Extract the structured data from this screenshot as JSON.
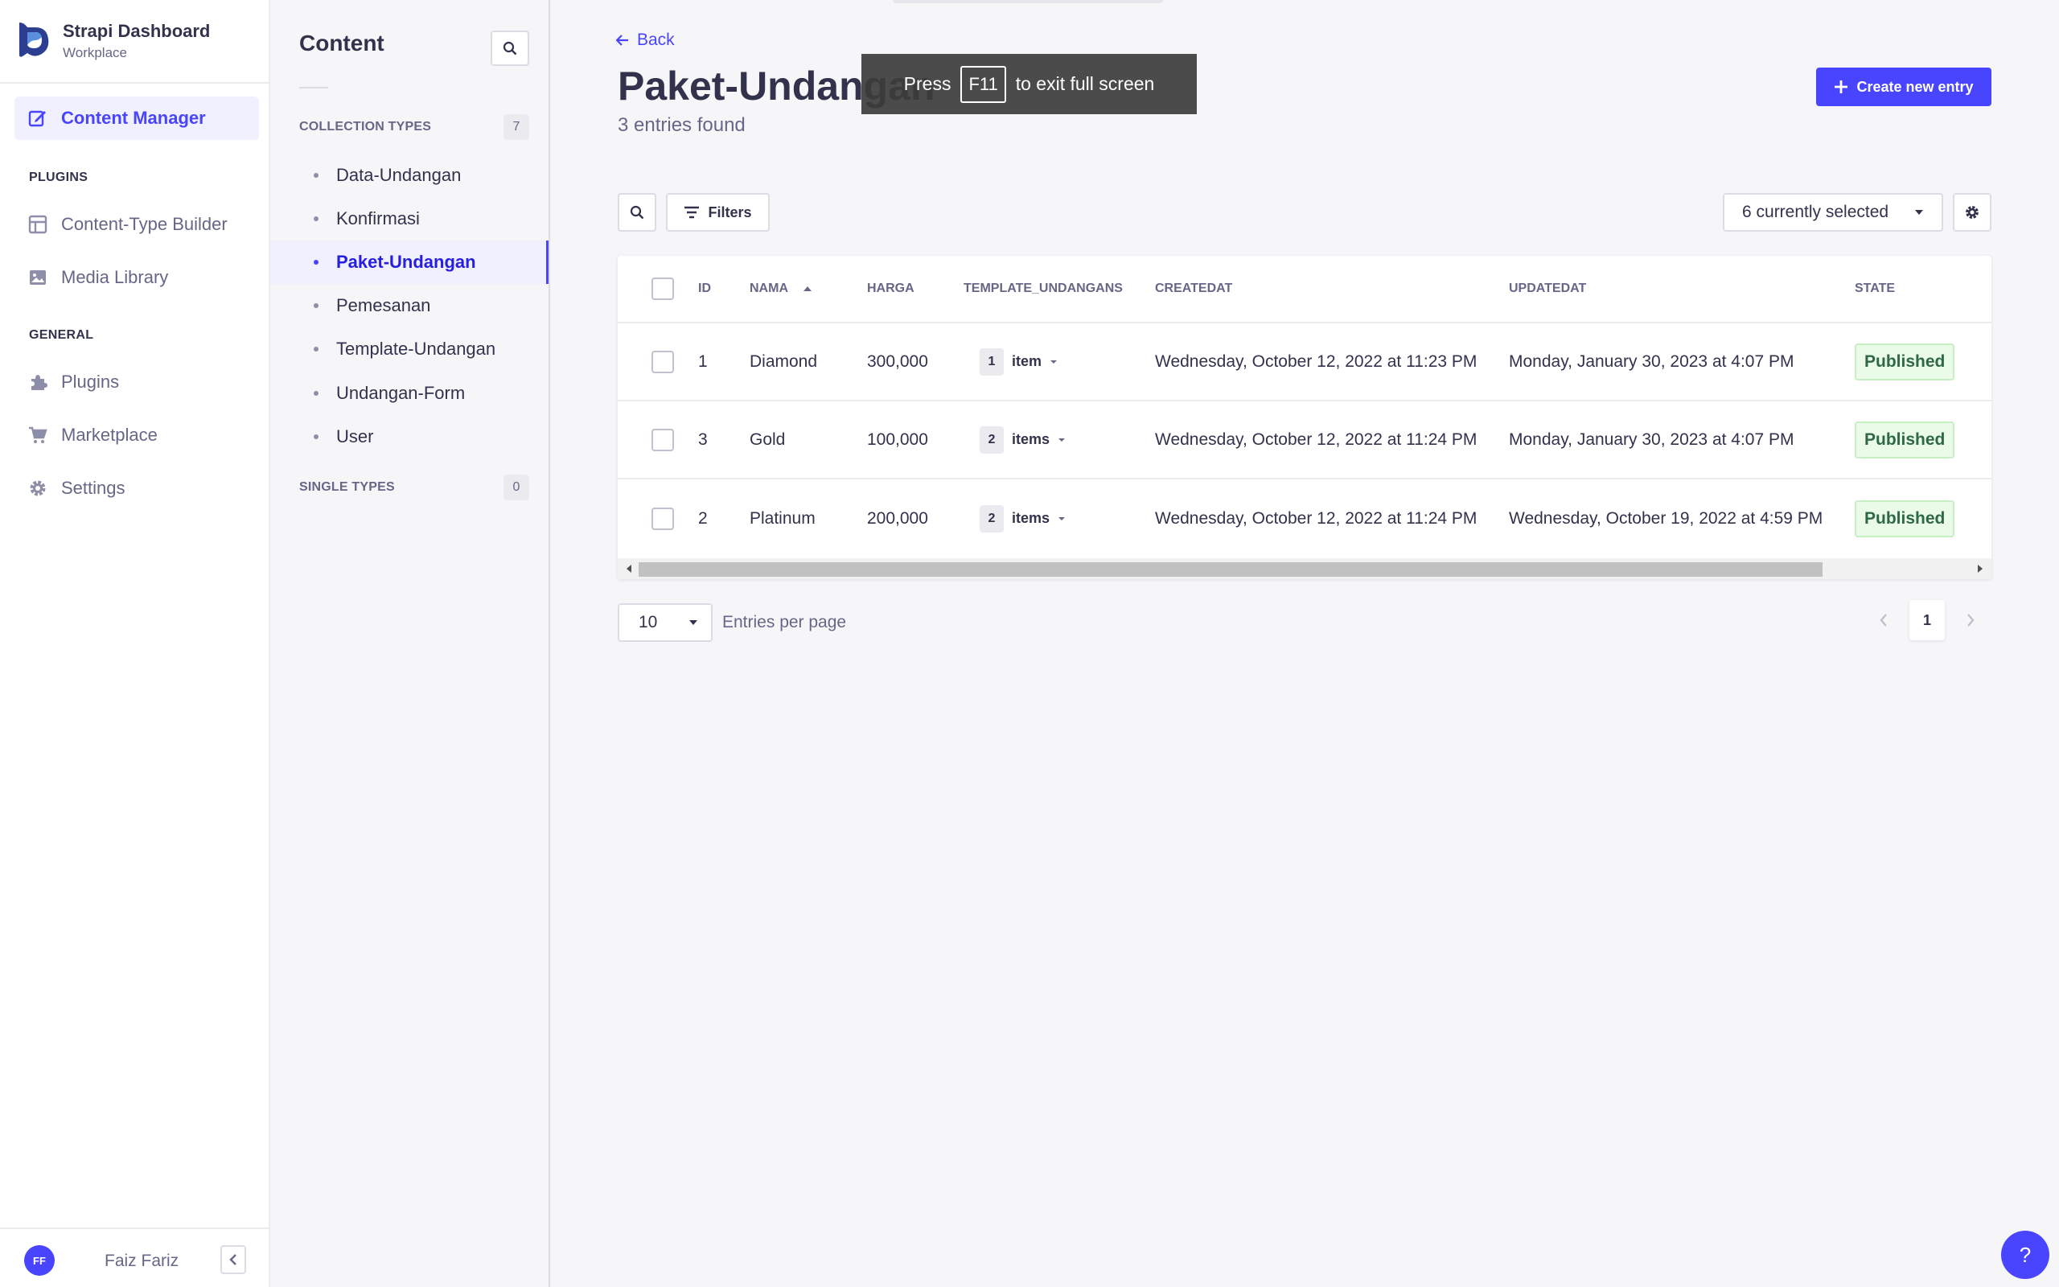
{
  "brand": {
    "title": "Strapi Dashboard",
    "subtitle": "Workplace"
  },
  "mainnav": {
    "content_manager": "Content Manager",
    "plugins_section": "PLUGINS",
    "content_type_builder": "Content-Type Builder",
    "media_library": "Media Library",
    "general_section": "GENERAL",
    "plugins": "Plugins",
    "marketplace": "Marketplace",
    "settings": "Settings"
  },
  "user": {
    "initials": "FF",
    "name": "Faiz Fariz"
  },
  "subnav": {
    "title": "Content",
    "collection_types_label": "COLLECTION TYPES",
    "collection_types_count": "7",
    "items": [
      "Data-Undangan",
      "Konfirmasi",
      "Paket-Undangan",
      "Pemesanan",
      "Template-Undangan",
      "Undangan-Form",
      "User"
    ],
    "active_item": "Paket-Undangan",
    "single_types_label": "SINGLE TYPES",
    "single_types_count": "0"
  },
  "header": {
    "back": "Back",
    "title": "Paket-Undangan",
    "subtitle": "3 entries found",
    "create_button": "Create new entry"
  },
  "fullscreen_toast": {
    "press": "Press",
    "key": "F11",
    "rest": "to exit full screen"
  },
  "toolbar": {
    "filters": "Filters",
    "columns_selected": "6 currently selected"
  },
  "table": {
    "columns": [
      "ID",
      "NAMA",
      "HARGA",
      "TEMPLATE_UNDANGANS",
      "CREATEDAT",
      "UPDATEDAT",
      "STATE"
    ],
    "rows": [
      {
        "id": "1",
        "nama": "Diamond",
        "harga": "300,000",
        "rel_count": "1",
        "rel_label": "item",
        "createdat": "Wednesday, October 12, 2022 at 11:23 PM",
        "updatedat": "Monday, January 30, 2023 at 4:07 PM",
        "state": "Published"
      },
      {
        "id": "3",
        "nama": "Gold",
        "harga": "100,000",
        "rel_count": "2",
        "rel_label": "items",
        "createdat": "Wednesday, October 12, 2022 at 11:24 PM",
        "updatedat": "Monday, January 30, 2023 at 4:07 PM",
        "state": "Published"
      },
      {
        "id": "2",
        "nama": "Platinum",
        "harga": "200,000",
        "rel_count": "2",
        "rel_label": "items",
        "createdat": "Wednesday, October 12, 2022 at 11:24 PM",
        "updatedat": "Wednesday, October 19, 2022 at 4:59 PM",
        "state": "Published"
      }
    ]
  },
  "pagination": {
    "per_page": "10",
    "per_page_label": "Entries per page",
    "current_page": "1"
  },
  "help": {
    "label": "?"
  },
  "colors": {
    "primary": "#4945ff",
    "published_bg": "#eafbe7",
    "published_text": "#2f6846"
  }
}
